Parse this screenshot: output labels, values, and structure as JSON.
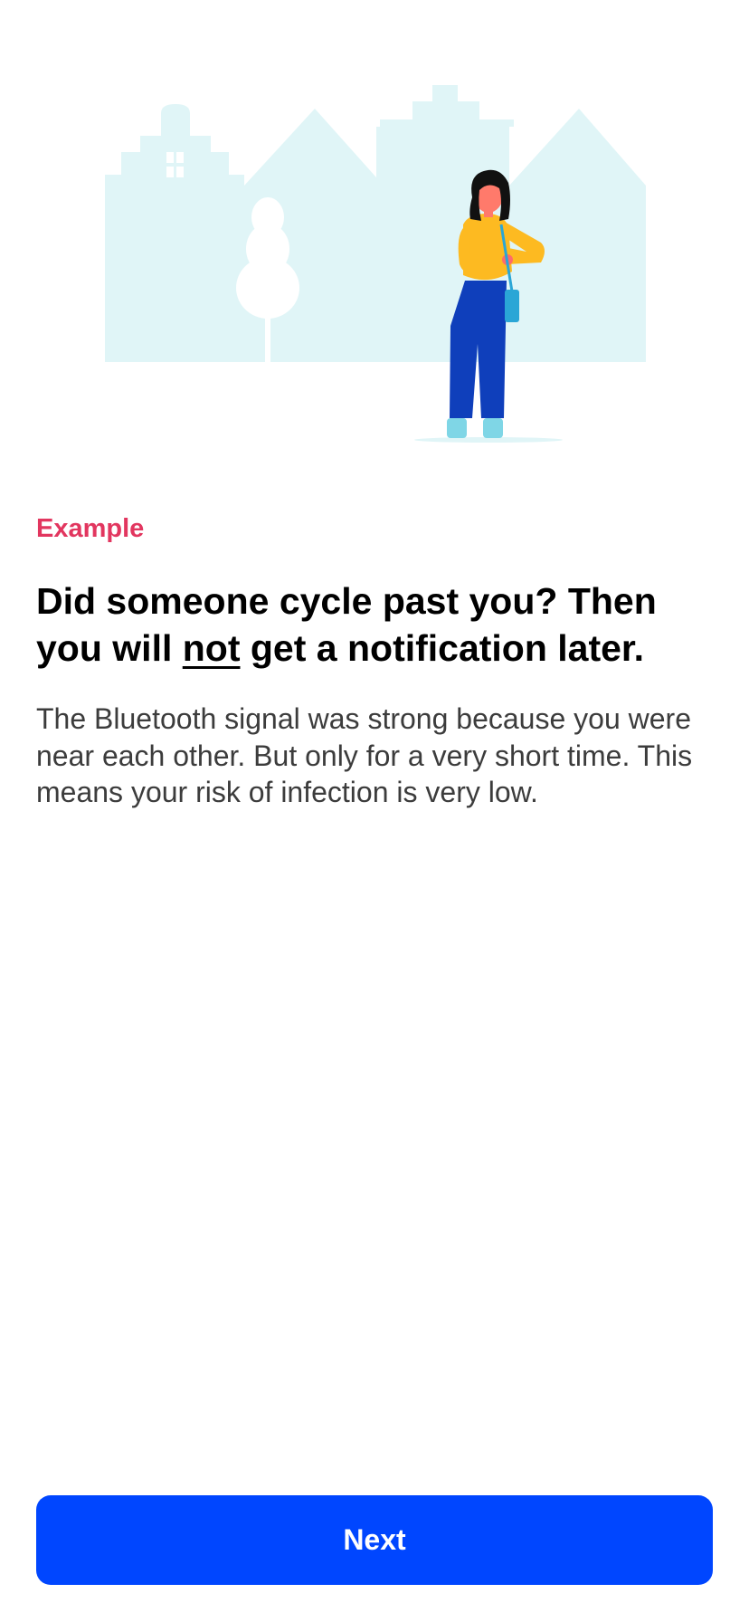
{
  "screen": {
    "eyebrow": "Example",
    "title": {
      "before": "Did someone cycle past you? Then you will ",
      "emphasis": "not",
      "after": " get a notification later."
    },
    "body": "The Bluetooth signal was strong because you were near each other. But only for a very short time. This means your risk of infection is very low.",
    "next_label": "Next"
  },
  "colors": {
    "accent_label": "#E2365F",
    "primary_button": "#0046FF",
    "illustration_background": "#E0F5F7"
  },
  "illustration": {
    "name": "woman-checking-watch-in-street"
  }
}
